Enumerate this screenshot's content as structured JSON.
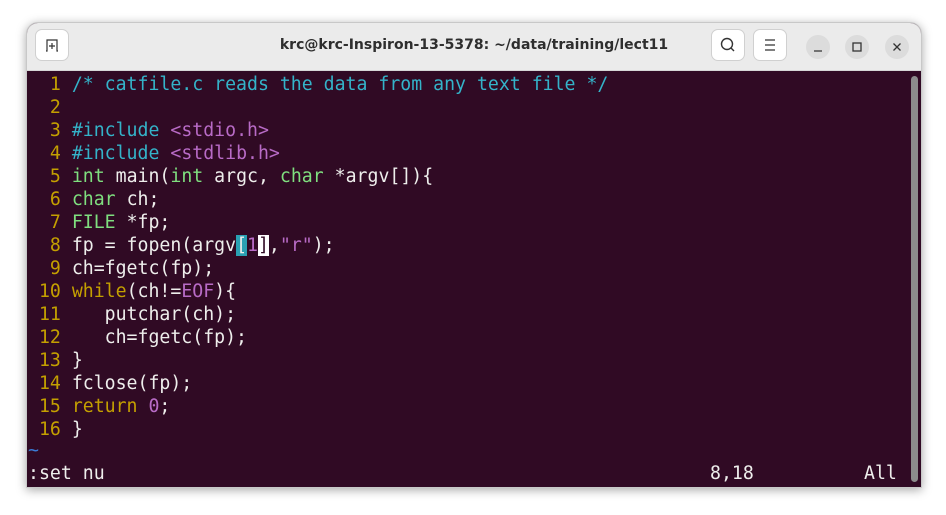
{
  "window": {
    "title": "krc@krc-Inspiron-13-5378: ~/data/training/lect11"
  },
  "titlebar_icons": {
    "new_tab": "new-tab-icon",
    "search": "search-icon",
    "menu": "hamburger-menu-icon",
    "minimize": "minimize-icon",
    "maximize": "maximize-icon",
    "close": "close-icon"
  },
  "colors": {
    "background": "#300a24",
    "line_number": "#c4a000",
    "comment": "#34b3c9",
    "type": "#7fdf7f",
    "string": "#b86bc6"
  },
  "editor": {
    "lines": [
      {
        "n": "1",
        "tokens": [
          {
            "t": "/* catfile.c reads the data from any text file */",
            "c": "cm"
          }
        ]
      },
      {
        "n": "2",
        "tokens": []
      },
      {
        "n": "3",
        "tokens": [
          {
            "t": "#include ",
            "c": "pp"
          },
          {
            "t": "<stdio.h>",
            "c": "inc"
          }
        ]
      },
      {
        "n": "4",
        "tokens": [
          {
            "t": "#include ",
            "c": "pp"
          },
          {
            "t": "<stdlib.h>",
            "c": "inc"
          }
        ]
      },
      {
        "n": "5",
        "tokens": [
          {
            "t": "int",
            "c": "ty"
          },
          {
            "t": " main(",
            "c": "tx"
          },
          {
            "t": "int",
            "c": "ty"
          },
          {
            "t": " argc, ",
            "c": "tx"
          },
          {
            "t": "char",
            "c": "ty"
          },
          {
            "t": " *argv[]){",
            "c": "tx"
          }
        ]
      },
      {
        "n": "6",
        "tokens": [
          {
            "t": "char",
            "c": "ty"
          },
          {
            "t": " ch;",
            "c": "tx"
          }
        ]
      },
      {
        "n": "7",
        "tokens": [
          {
            "t": "FILE",
            "c": "ty"
          },
          {
            "t": " *fp;",
            "c": "tx"
          }
        ]
      },
      {
        "n": "8",
        "tokens": [
          {
            "t": "fp = fopen(argv",
            "c": "tx"
          },
          {
            "t": "[",
            "c": "mp"
          },
          {
            "t": "1",
            "c": "nu"
          },
          {
            "t": "]",
            "c": "cur"
          },
          {
            "t": ",",
            "c": "tx"
          },
          {
            "t": "\"r\"",
            "c": "st"
          },
          {
            "t": ");",
            "c": "tx"
          }
        ]
      },
      {
        "n": "9",
        "tokens": [
          {
            "t": "ch=fgetc(fp);",
            "c": "tx"
          }
        ]
      },
      {
        "n": "10",
        "tokens": [
          {
            "t": "while",
            "c": "kw"
          },
          {
            "t": "(ch!=",
            "c": "tx"
          },
          {
            "t": "EOF",
            "c": "nu"
          },
          {
            "t": "){",
            "c": "tx"
          }
        ]
      },
      {
        "n": "11",
        "tokens": [
          {
            "t": "   putchar(ch);",
            "c": "tx"
          }
        ]
      },
      {
        "n": "12",
        "tokens": [
          {
            "t": "   ch=fgetc(fp);",
            "c": "tx"
          }
        ]
      },
      {
        "n": "13",
        "tokens": [
          {
            "t": "}",
            "c": "tx"
          }
        ]
      },
      {
        "n": "14",
        "tokens": [
          {
            "t": "fclose(fp);",
            "c": "tx"
          }
        ]
      },
      {
        "n": "15",
        "tokens": [
          {
            "t": "return",
            "c": "kw"
          },
          {
            "t": " ",
            "c": "tx"
          },
          {
            "t": "0",
            "c": "nu"
          },
          {
            "t": ";",
            "c": "tx"
          }
        ]
      },
      {
        "n": "16",
        "tokens": [
          {
            "t": "}",
            "c": "tx"
          }
        ]
      }
    ],
    "tilde": "~",
    "command": ":set nu",
    "cursor_position": "8,18",
    "scroll_position": "All"
  }
}
